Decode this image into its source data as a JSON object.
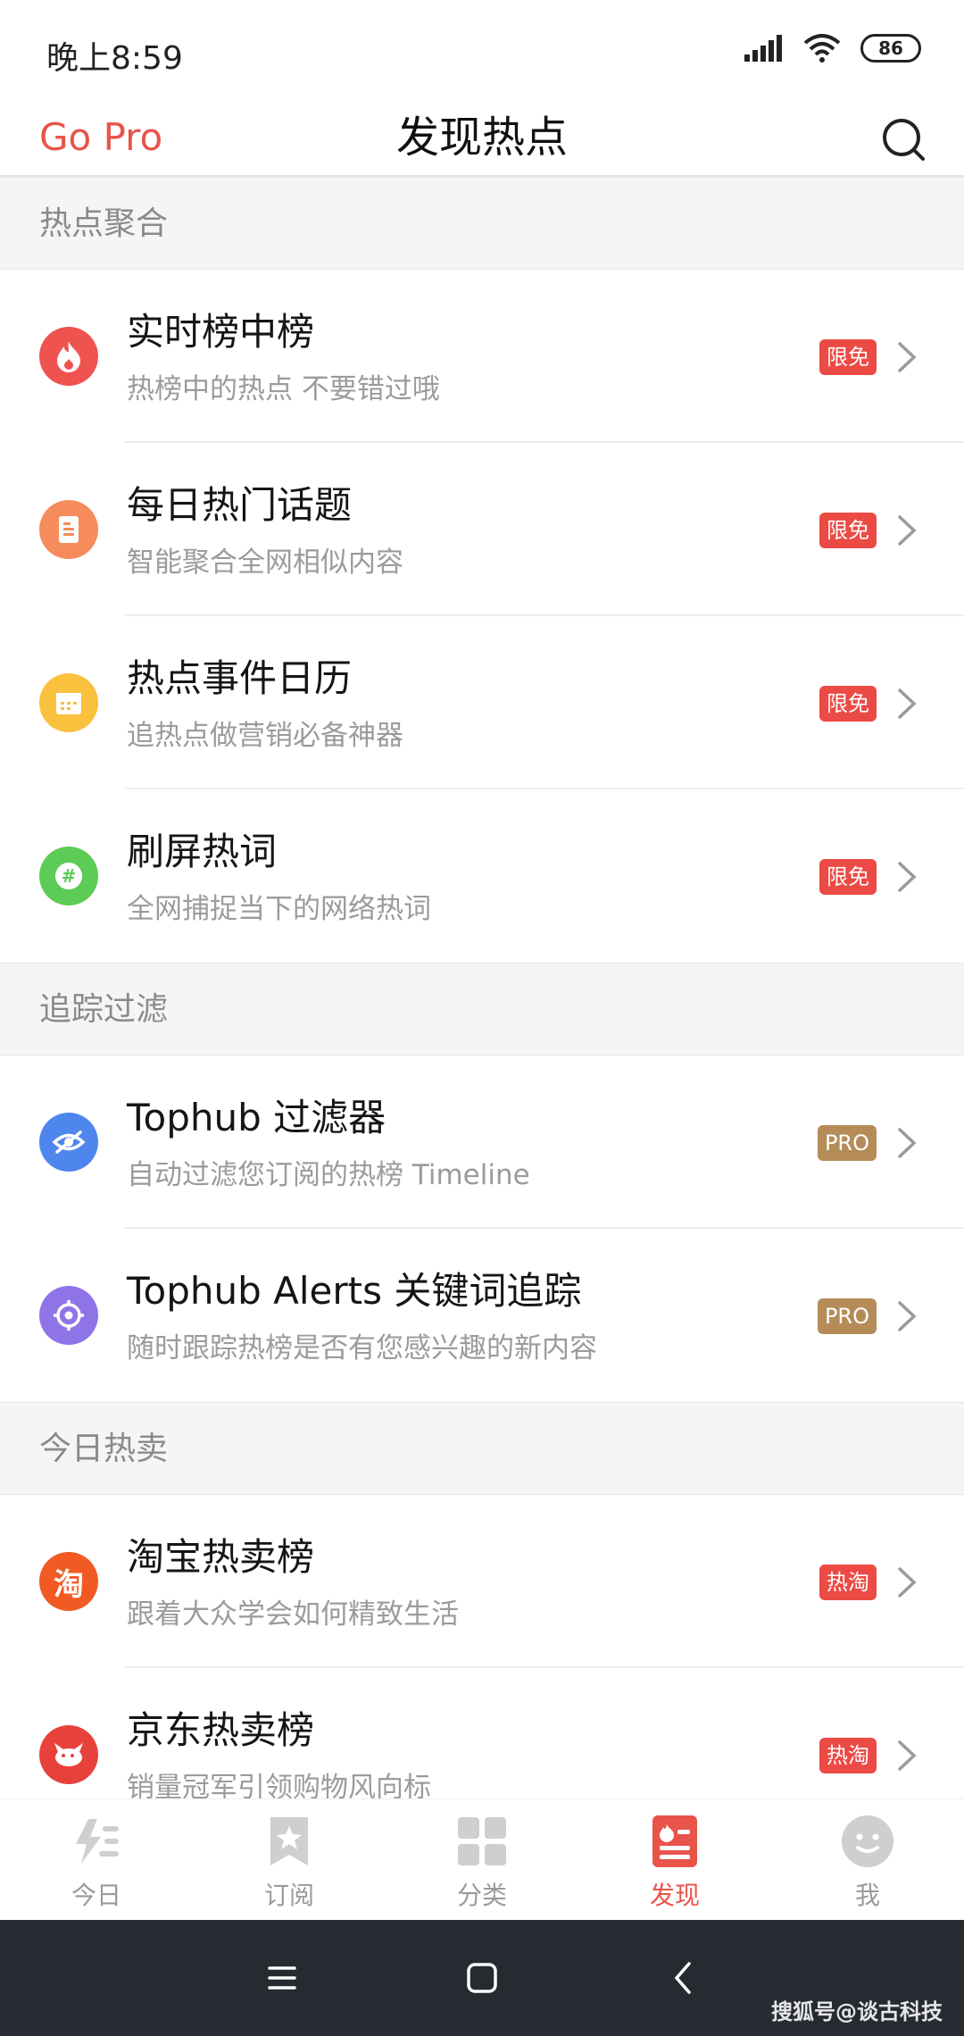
{
  "status_bar": {
    "time": "晚上8:59",
    "battery": "86"
  },
  "header": {
    "go_pro": "Go Pro",
    "title": "发现热点",
    "search_icon": "search-icon"
  },
  "sections": [
    {
      "title": "热点聚合",
      "items": [
        {
          "title": "实时榜中榜",
          "subtitle": "热榜中的热点 不要错过哦",
          "badge": "限免",
          "icon": "flame-icon",
          "icon_color": "#ef5350"
        },
        {
          "title": "每日热门话题",
          "subtitle": "智能聚合全网相似内容",
          "badge": "限免",
          "icon": "document-icon",
          "icon_color": "#f68b5c"
        },
        {
          "title": "热点事件日历",
          "subtitle": "追热点做营销必备神器",
          "badge": "限免",
          "icon": "calendar-icon",
          "icon_color": "#f9c13e"
        },
        {
          "title": "刷屏热词",
          "subtitle": "全网捕捉当下的网络热词",
          "badge": "限免",
          "icon": "hashtag-icon",
          "icon_color": "#5dcc57"
        }
      ]
    },
    {
      "title": "追踪过滤",
      "items": [
        {
          "title": "Tophub 过滤器",
          "subtitle": "自动过滤您订阅的热榜 Timeline",
          "badge": "PRO",
          "icon": "eye-slash-icon",
          "icon_color": "#4e86ee"
        },
        {
          "title": "Tophub Alerts 关键词追踪",
          "subtitle": "随时跟踪热榜是否有您感兴趣的新内容",
          "badge": "PRO",
          "icon": "target-icon",
          "icon_color": "#8f74e8"
        }
      ]
    },
    {
      "title": "今日热卖",
      "items": [
        {
          "title": "淘宝热卖榜",
          "subtitle": "跟着大众学会如何精致生活",
          "badge": "热淘",
          "icon": "taobao-icon",
          "icon_glyph": "淘",
          "icon_color": "#f25a24"
        },
        {
          "title": "京东热卖榜",
          "subtitle": "销量冠军引领购物风向标",
          "badge": "热淘",
          "icon": "jd-dog-icon",
          "icon_color": "#e8413c"
        }
      ]
    }
  ],
  "bottom_nav": [
    {
      "label": "今日",
      "icon": "today-icon"
    },
    {
      "label": "订阅",
      "icon": "bookmark-star-icon"
    },
    {
      "label": "分类",
      "icon": "grid-icon"
    },
    {
      "label": "发现",
      "icon": "discover-icon",
      "active": true
    },
    {
      "label": "我",
      "icon": "profile-face-icon"
    }
  ],
  "colors": {
    "accent": "#e8534a",
    "badge_free": "#ec4a45",
    "badge_pro": "#b58c58"
  },
  "watermark": "搜狐号@谈古科技"
}
